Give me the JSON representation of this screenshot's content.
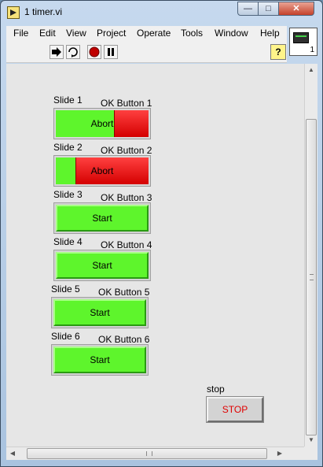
{
  "window": {
    "title": "1 timer.vi",
    "controls": {
      "minimize": "—",
      "maximize": "□",
      "close": "✕"
    }
  },
  "menu": [
    "File",
    "Edit",
    "View",
    "Project",
    "Operate",
    "Tools",
    "Window",
    "Help"
  ],
  "toolbar": {
    "icons": [
      "run-arrow-icon",
      "run-continuously-icon",
      "abort-icon",
      "pause-icon",
      "help-icon"
    ],
    "help_label": "?"
  },
  "connector_pane": {
    "number": "1",
    "icon": "vi-connector-icon"
  },
  "slides": [
    {
      "label": "Slide 1",
      "button_label": "OK Button 1",
      "caption": "Abort",
      "green_fraction": 0.62,
      "state": "running"
    },
    {
      "label": "Slide 2",
      "button_label": "OK Button 2",
      "caption": "Abort",
      "green_fraction": 0.21,
      "state": "running"
    },
    {
      "label": "Slide 3",
      "button_label": "OK Button 3",
      "caption": "Start",
      "state": "idle"
    },
    {
      "label": "Slide 4",
      "button_label": "OK Button 4",
      "caption": "Start",
      "state": "idle"
    },
    {
      "label": "Slide 5",
      "button_label": "OK Button 5",
      "caption": "Start",
      "state": "idle"
    },
    {
      "label": "Slide 6",
      "button_label": "OK Button 6",
      "caption": "Start",
      "state": "idle"
    }
  ],
  "stop": {
    "label": "stop",
    "button_text": "STOP",
    "text_color": "#e00000"
  },
  "colors": {
    "green": "#5ef52c",
    "red": "#e00000",
    "panel": "#e6e6e6"
  }
}
